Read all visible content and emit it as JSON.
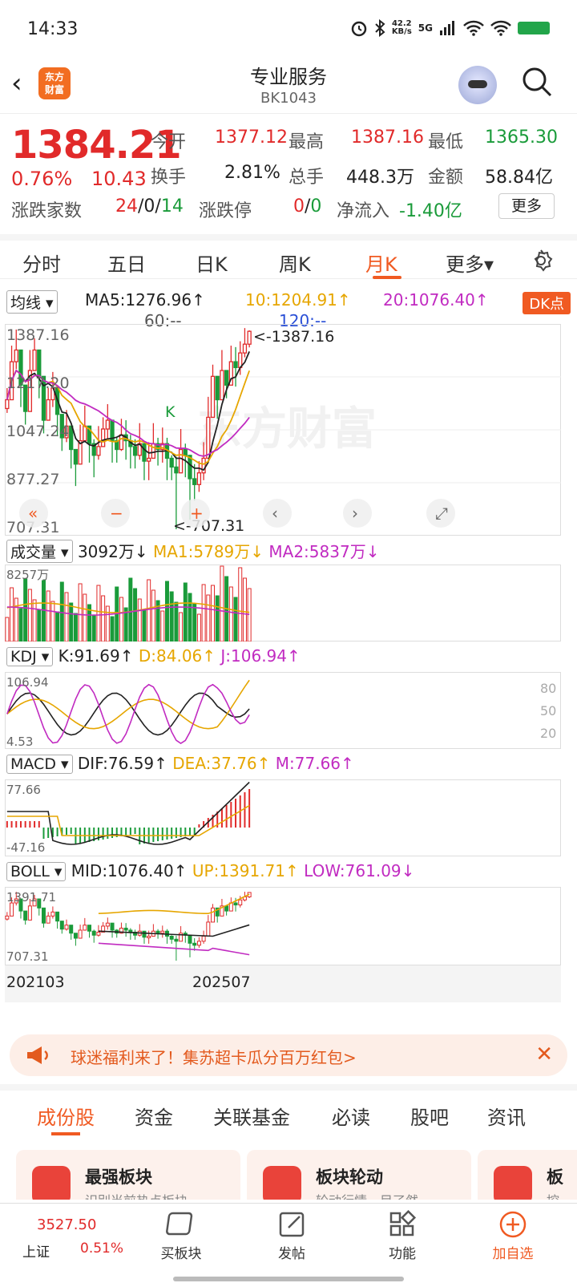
{
  "status": {
    "time": "14:33",
    "speed_top": "42.2",
    "speed_unit": "KB/s",
    "network": "5G"
  },
  "header": {
    "back_icon": "back-chevron-icon",
    "logo_text_1": "东方",
    "logo_text_2": "财富",
    "title": "专业服务",
    "code": "BK1043"
  },
  "quote": {
    "price": "1384.21",
    "change_pct": "0.76%",
    "change": "10.43",
    "open_label": "今开",
    "open": "1377.12",
    "high_label": "最高",
    "high": "1387.16",
    "low_label": "最低",
    "low": "1365.30",
    "turnover_label": "换手",
    "turnover": "2.81%",
    "volume_label": "总手",
    "volume": "448.3万",
    "amount_label": "金额",
    "amount": "58.84亿",
    "breadth_label": "涨跌家数",
    "breadth_up": "24",
    "breadth_flat": "0",
    "breadth_down": "14",
    "limit_label": "涨跌停",
    "limit_up": "0",
    "limit_down": "0",
    "inflow_label": "净流入",
    "inflow": "-1.40亿",
    "more": "更多"
  },
  "period_tabs": [
    "分时",
    "五日",
    "日K",
    "周K",
    "月K",
    "更多▾"
  ],
  "indicators": {
    "ma_sel": "均线",
    "ma5": "MA5:1276.96↑",
    "ma10": "10:1204.91↑",
    "ma20": "20:1076.40↑",
    "ma60": "60:--",
    "ma120": "120:--",
    "dk": "DK点",
    "vol_sel": "成交量",
    "vol": "3092万↓",
    "vol_ma1": "MA1:5789万↓",
    "vol_ma2": "MA2:5837万↓",
    "kdj_sel": "KDJ",
    "k": "K:91.69↑",
    "d": "D:84.06↑",
    "j": "J:106.94↑",
    "macd_sel": "MACD",
    "dif": "DIF:76.59↑",
    "dea": "DEA:37.76↑",
    "m": "M:77.66↑",
    "boll_sel": "BOLL",
    "mid": "MID:1076.40↑",
    "up": "UP:1391.71↑",
    "low": "LOW:761.09↓"
  },
  "chart_data": {
    "type": "candlestick",
    "main_ticks": [
      "1387.16",
      "1217.20",
      "1047.24",
      "877.27",
      "707.31"
    ],
    "max_label": "<-1387.16",
    "min_label": "<-707.31",
    "signal": "K",
    "vol_tick": "8257万",
    "kdj_ticks": [
      "106.94",
      "4.53"
    ],
    "kdj_levels": [
      "80",
      "50",
      "20"
    ],
    "macd_ticks": [
      "77.66",
      "-47.16"
    ],
    "boll_ticks": [
      "1391.71",
      "707.31"
    ],
    "x_labels": [
      "202103",
      "202507"
    ],
    "watermark": "东方财富"
  },
  "banner": {
    "text": "球迷福利来了！集苏超卡瓜分百万红包>",
    "close": "✕"
  },
  "bottom_tabs": [
    "成份股",
    "资金",
    "关联基金",
    "必读",
    "股吧",
    "资讯"
  ],
  "cards": [
    {
      "title": "最强板块",
      "desc": "识别当前热点板块"
    },
    {
      "title": "板块轮动",
      "desc": "轮动行情一目了然"
    },
    {
      "title": "板",
      "desc": "挖"
    }
  ],
  "nav": {
    "index_name": "上证",
    "index_value": "3527.50",
    "index_pct": "0.51%",
    "items": [
      "买板块",
      "发帖",
      "功能",
      "加自选"
    ]
  }
}
